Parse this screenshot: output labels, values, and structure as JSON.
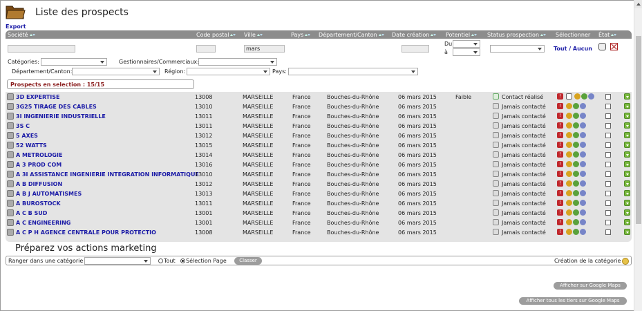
{
  "page": {
    "title": "Liste des prospects",
    "export_label": "Export",
    "marketing_title": "Préparez vos actions marketing"
  },
  "headers": {
    "societe": "Société",
    "code_postal": "Code postal",
    "ville": "Ville",
    "pays": "Pays",
    "departement": "Département/Canton",
    "date_creation": "Date création",
    "potentiel": "Potentiel",
    "status": "Status prospection",
    "selectionner": "Sélectionner",
    "etat": "État"
  },
  "filters": {
    "ville_value": "mars",
    "du_label": "Du",
    "a_label": "à",
    "tout_aucun": "Tout / Aucun",
    "categories_label": "Catégories:",
    "gestionnaires_label": "Gestionnaires/Commerciaux:",
    "departement_label": "Département/Canton:",
    "region_label": "Région:",
    "pays_label": "Pays:",
    "selection_count": "Prospects en selection : 15/15"
  },
  "rows": [
    {
      "name": "3D EXPERTISE",
      "cp": "13008",
      "ville": "MARSEILLE",
      "pays": "France",
      "dept": "Bouches-du-Rhône",
      "date": "06 mars 2015",
      "potentiel": "Faible",
      "status": "Contact réalisé"
    },
    {
      "name": "3G25 TIRAGE DES CABLES",
      "cp": "13010",
      "ville": "MARSEILLE",
      "pays": "France",
      "dept": "Bouches-du-Rhône",
      "date": "06 mars 2015",
      "potentiel": "",
      "status": "Jamais contacté"
    },
    {
      "name": "3I INGENIERIE INDUSTRIELLE",
      "cp": "13011",
      "ville": "MARSEILLE",
      "pays": "France",
      "dept": "Bouches-du-Rhône",
      "date": "06 mars 2015",
      "potentiel": "",
      "status": "Jamais contacté"
    },
    {
      "name": "3S C",
      "cp": "13011",
      "ville": "MARSEILLE",
      "pays": "France",
      "dept": "Bouches-du-Rhône",
      "date": "06 mars 2015",
      "potentiel": "",
      "status": "Jamais contacté"
    },
    {
      "name": "5 AXES",
      "cp": "13012",
      "ville": "MARSEILLE",
      "pays": "France",
      "dept": "Bouches-du-Rhône",
      "date": "06 mars 2015",
      "potentiel": "",
      "status": "Jamais contacté"
    },
    {
      "name": "52 WATTS",
      "cp": "13015",
      "ville": "MARSEILLE",
      "pays": "France",
      "dept": "Bouches-du-Rhône",
      "date": "06 mars 2015",
      "potentiel": "",
      "status": "Jamais contacté"
    },
    {
      "name": "A METROLOGIE",
      "cp": "13014",
      "ville": "MARSEILLE",
      "pays": "France",
      "dept": "Bouches-du-Rhône",
      "date": "06 mars 2015",
      "potentiel": "",
      "status": "Jamais contacté"
    },
    {
      "name": "A 3 PROD COM",
      "cp": "13016",
      "ville": "MARSEILLE",
      "pays": "France",
      "dept": "Bouches-du-Rhône",
      "date": "06 mars 2015",
      "potentiel": "",
      "status": "Jamais contacté"
    },
    {
      "name": "A 3I ASSISTANCE INGENIERIE INTEGRATION INFORMATIQUE",
      "cp": "13010",
      "ville": "MARSEILLE",
      "pays": "France",
      "dept": "Bouches-du-Rhône",
      "date": "06 mars 2015",
      "potentiel": "",
      "status": "Jamais contacté"
    },
    {
      "name": "A B DIFFUSION",
      "cp": "13012",
      "ville": "MARSEILLE",
      "pays": "France",
      "dept": "Bouches-du-Rhône",
      "date": "06 mars 2015",
      "potentiel": "",
      "status": "Jamais contacté"
    },
    {
      "name": "A B J AUTOMATISMES",
      "cp": "13013",
      "ville": "MARSEILLE",
      "pays": "France",
      "dept": "Bouches-du-Rhône",
      "date": "06 mars 2015",
      "potentiel": "",
      "status": "Jamais contacté"
    },
    {
      "name": "A BUROSTOCK",
      "cp": "13011",
      "ville": "MARSEILLE",
      "pays": "France",
      "dept": "Bouches-du-Rhône",
      "date": "06 mars 2015",
      "potentiel": "",
      "status": "Jamais contacté"
    },
    {
      "name": "A C B SUD",
      "cp": "13001",
      "ville": "MARSEILLE",
      "pays": "France",
      "dept": "Bouches-du-Rhône",
      "date": "06 mars 2015",
      "potentiel": "",
      "status": "Jamais contacté"
    },
    {
      "name": "A C ENGINEERING",
      "cp": "13001",
      "ville": "MARSEILLE",
      "pays": "France",
      "dept": "Bouches-du-Rhône",
      "date": "06 mars 2015",
      "potentiel": "",
      "status": "Jamais contacté"
    },
    {
      "name": "A C P H AGENCE CENTRALE POUR PROTECTIO",
      "cp": "13008",
      "ville": "MARSEILLE",
      "pays": "France",
      "dept": "Bouches-du-Rhône",
      "date": "06 mars 2015",
      "potentiel": "",
      "status": "Jamais contacté"
    }
  ],
  "marketing": {
    "ranger_label": "Ranger dans une catégorie",
    "tout_label": "Tout",
    "selection_page_label": "Sélection Page",
    "classer_button": "Classer",
    "creation_categorie": "Création de la catégorie"
  },
  "buttons": {
    "google_maps": "Afficher sur Google Maps",
    "google_maps_all": "Afficher tous les tiers sur Google Maps"
  }
}
